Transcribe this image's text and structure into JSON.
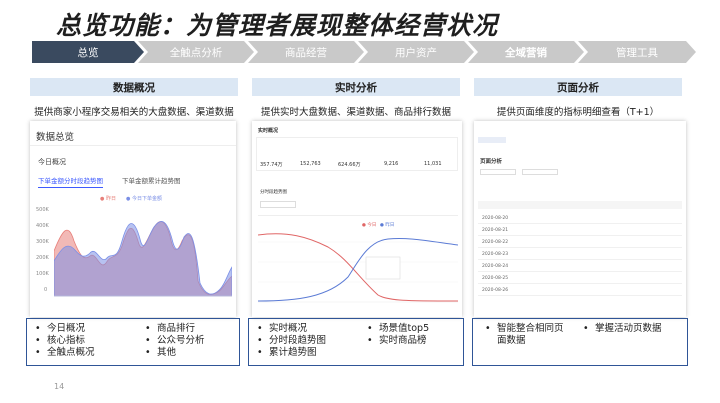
{
  "page": {
    "title": "总览功能：为管理者展现整体经营状况",
    "page_number": "14"
  },
  "nav": {
    "steps": [
      {
        "label": "总览",
        "state": "active"
      },
      {
        "label": "全触点分析",
        "state": "inactive"
      },
      {
        "label": "商品经营",
        "state": "inactive"
      },
      {
        "label": "用户资产",
        "state": "inactive"
      },
      {
        "label": "全域营销",
        "state": "inactive-bold"
      },
      {
        "label": "管理工具",
        "state": "inactive"
      }
    ]
  },
  "columns": [
    {
      "header": "数据概况",
      "description": "提供商家小程序交易相关的大盘数据、渠道数据",
      "features": [
        "今日概况",
        "核心指标",
        "全触点概况",
        "商品排行",
        "公众号分析",
        "其他"
      ]
    },
    {
      "header": "实时分析",
      "description": "提供实时大盘数据、渠道数据、商品排行数据",
      "features": [
        "实时概况",
        "分时段趋势图",
        "累计趋势图",
        "场景值top5",
        "实时商品榜"
      ]
    },
    {
      "header": "页面分析",
      "description": "提供页面维度的指标明细查看（T+1）",
      "features": [
        "智能整合相同页面数据",
        "掌握活动页数据"
      ]
    }
  ],
  "screenshot1": {
    "title": "数据总览",
    "subtitle": "今日概况",
    "tab_active": "下单金额分时段趋势图",
    "tab_inactive": "下单金额累计趋势图",
    "legend": [
      "昨日",
      "今日下单金额"
    ],
    "y_ticks": [
      "500K",
      "400K",
      "300K",
      "200K",
      "100K",
      "0"
    ],
    "colors": {
      "series_yesterday": "#e8807a",
      "series_today": "#7b8fe6",
      "accent": "#3d5afe"
    }
  },
  "screenshot2": {
    "title": "实时概况",
    "metrics": [
      "357.74万",
      "152,763",
      "624.66万",
      "9,216",
      "11,031"
    ],
    "chart_title": "分时段趋势图",
    "legend": [
      "今日",
      "昨日"
    ],
    "colors": {
      "series_red": "#e06666",
      "series_blue": "#5b7bd5"
    }
  },
  "screenshot3": {
    "title": "页面分析",
    "dates": [
      "2020-08-20",
      "2020-08-21",
      "2020-08-22",
      "2020-08-23",
      "2020-08-24",
      "2020-08-25",
      "2020-08-26"
    ]
  },
  "colors": {
    "nav_active": "#3a4a5f",
    "nav_inactive": "#c9c9c9",
    "header_bg": "#dbe7f4",
    "feature_border": "#2f5597"
  }
}
